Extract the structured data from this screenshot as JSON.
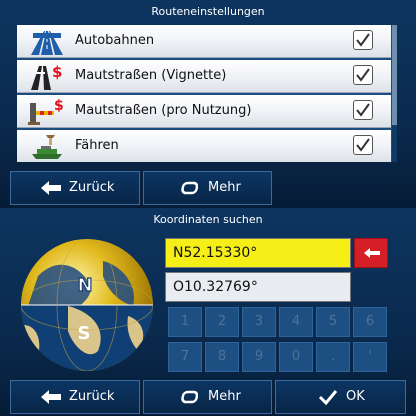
{
  "route_settings": {
    "title": "Routeneinstellungen",
    "items": [
      {
        "label": "Autobahnen",
        "icon": "highway-icon",
        "checked": true
      },
      {
        "label": "Mautstraßen (Vignette)",
        "icon": "toll-road-vignette-icon",
        "checked": true
      },
      {
        "label": "Mautstraßen (pro Nutzung)",
        "icon": "toll-road-per-use-icon",
        "checked": true
      },
      {
        "label": "Fähren",
        "icon": "ferry-icon",
        "checked": true
      }
    ],
    "back_label": "Zurück",
    "more_label": "Mehr"
  },
  "coordinates": {
    "title": "Koordinaten suchen",
    "latitude": "N52.15330°",
    "longitude": "O10.32769°",
    "globe_north_label": "N",
    "globe_south_label": "S",
    "keypad": [
      "1",
      "2",
      "3",
      "4",
      "5",
      "6",
      "7",
      "8",
      "9",
      "0",
      ".",
      "'"
    ],
    "back_label": "Zurück",
    "more_label": "Mehr",
    "ok_label": "OK"
  },
  "colors": {
    "background": "#0a2a4e",
    "active_field": "#f5ef17",
    "backspace": "#d51f26"
  }
}
